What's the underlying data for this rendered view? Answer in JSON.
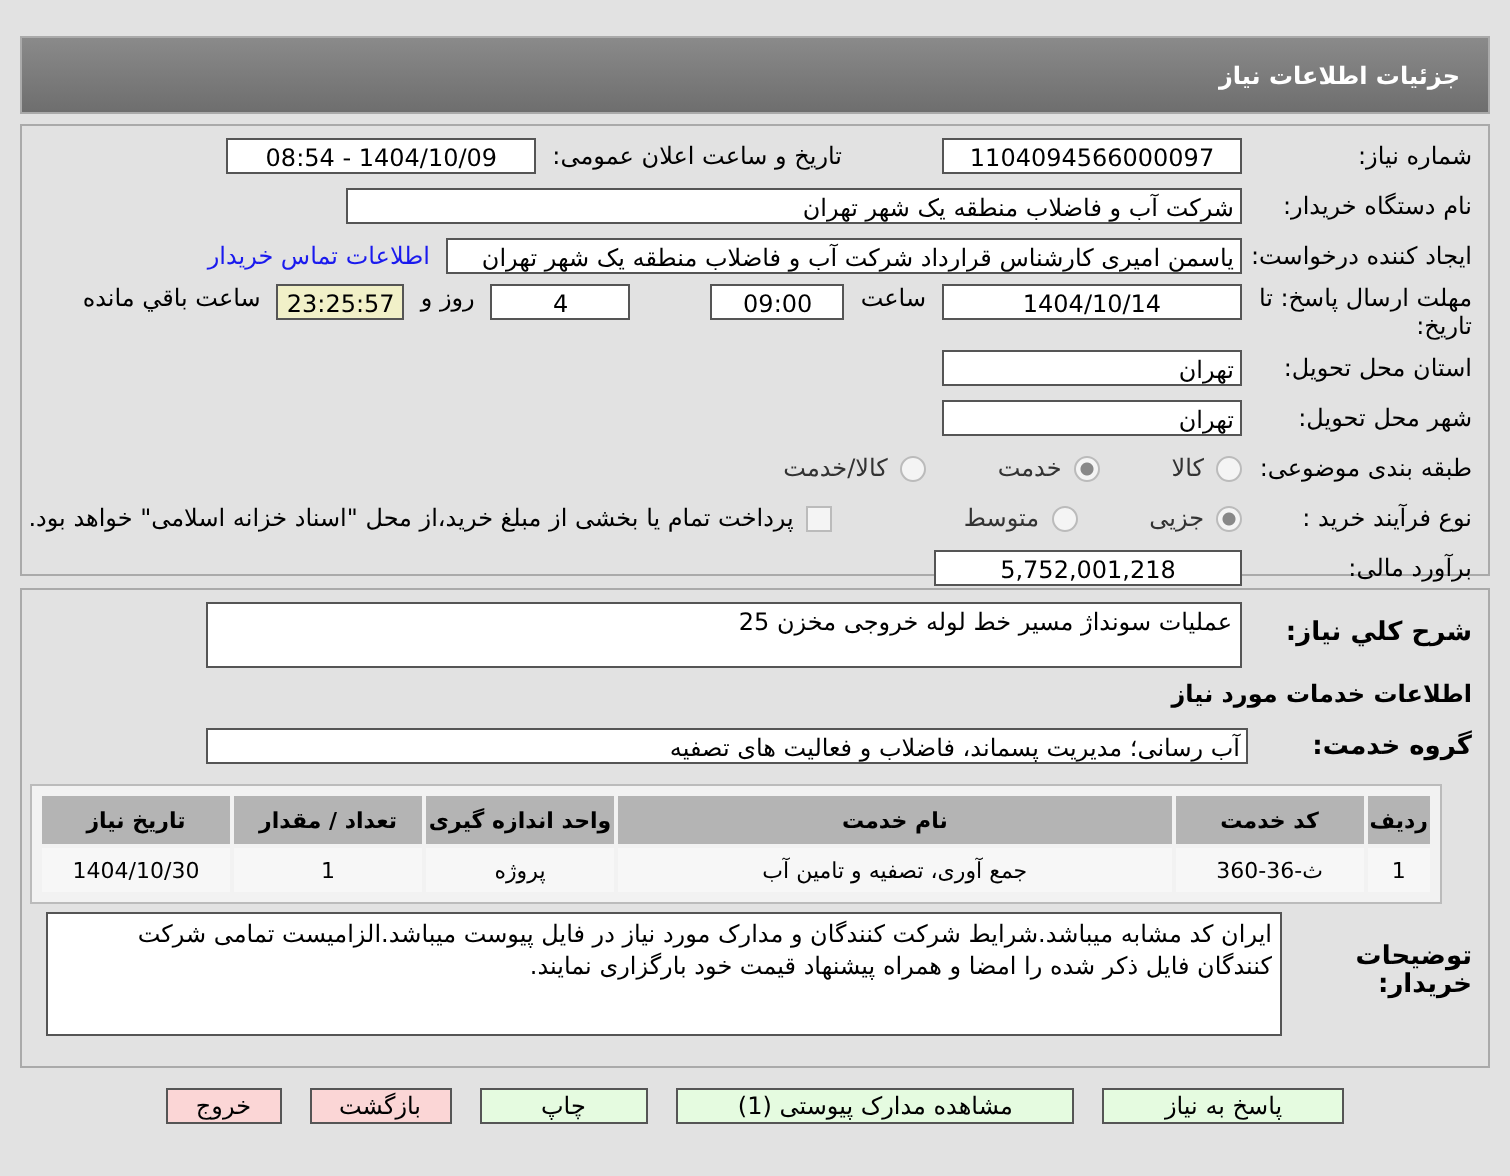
{
  "header": {
    "title": "جزئیات اطلاعات نیاز"
  },
  "need_number": {
    "label": "شماره نیاز:",
    "value": "1104094566000097"
  },
  "announce": {
    "label": "تاریخ و ساعت اعلان عمومی:",
    "value": "1404/10/09 - 08:54"
  },
  "buyer": {
    "label": "نام دستگاه خریدار:",
    "value": "شرکت آب و فاضلاب منطقه یک شهر تهران"
  },
  "creator": {
    "label": "ایجاد کننده درخواست:",
    "value": "یاسمن امیری کارشناس قرارداد شرکت آب و فاضلاب منطقه یک شهر تهران",
    "link": "اطلاعات تماس خریدار"
  },
  "deadline": {
    "label": "مهلت ارسال پاسخ: تا تاریخ:",
    "date": "1404/10/14",
    "time_label": "ساعت",
    "time": "09:00",
    "days": "4",
    "days_label": "روز و",
    "remaining": "23:25:57",
    "remaining_label": "ساعت باقي مانده"
  },
  "province": {
    "label": "استان محل تحویل:",
    "value": "تهران"
  },
  "city": {
    "label": "شهر محل تحویل:",
    "value": "تهران"
  },
  "category": {
    "label": "طبقه بندی موضوعی:",
    "options": [
      {
        "label": "کالا",
        "selected": false
      },
      {
        "label": "خدمت",
        "selected": true
      },
      {
        "label": "کالا/خدمت",
        "selected": false
      }
    ]
  },
  "process": {
    "label": "نوع فرآیند خرید :",
    "options": [
      {
        "label": "جزیی",
        "selected": true
      },
      {
        "label": "متوسط",
        "selected": false
      }
    ],
    "payment": {
      "checked": false,
      "text": "پرداخت تمام یا بخشی از مبلغ خرید،از محل \"اسناد خزانه اسلامی\" خواهد بود."
    }
  },
  "estimate": {
    "label": "برآورد مالی:",
    "value": "5,752,001,218"
  },
  "description": {
    "label": "شرح کلي نیاز:",
    "value": "عملیات سونداژ مسیر خط لوله خروجی مخزن 25"
  },
  "services_heading": "اطلاعات خدمات مورد نیاز",
  "service_group": {
    "label": "گروه خدمت:",
    "value": "آب رسانی؛ مدیریت پسماند، فاضلاب و فعالیت های تصفیه"
  },
  "table": {
    "columns": [
      "ردیف",
      "کد خدمت",
      "نام خدمت",
      "واحد اندازه گیری",
      "تعداد / مقدار",
      "تاریخ نیاز"
    ],
    "rows": [
      [
        "1",
        "ث-36-360",
        "جمع آوری، تصفیه و تامین آب",
        "پروژه",
        "1",
        "1404/10/30"
      ]
    ]
  },
  "notes": {
    "label": "توضیحات خریدار:",
    "value": "ایران کد مشابه میباشد.شرایط شرکت کنندگان و مدارک مورد نیاز در فایل پیوست میباشد.الزامیست تمامی شرکت کنندگان فایل ذکر شده را امضا و همراه پیشنهاد قیمت خود بارگزاری نمایند."
  },
  "buttons": [
    {
      "label": "پاسخ به نیاز",
      "kind": "green"
    },
    {
      "label": "مشاهده مدارک پیوستی (1)",
      "kind": "green"
    },
    {
      "label": "چاپ",
      "kind": "green"
    },
    {
      "label": "بازگشت",
      "kind": "red"
    },
    {
      "label": "خروج",
      "kind": "red"
    }
  ]
}
